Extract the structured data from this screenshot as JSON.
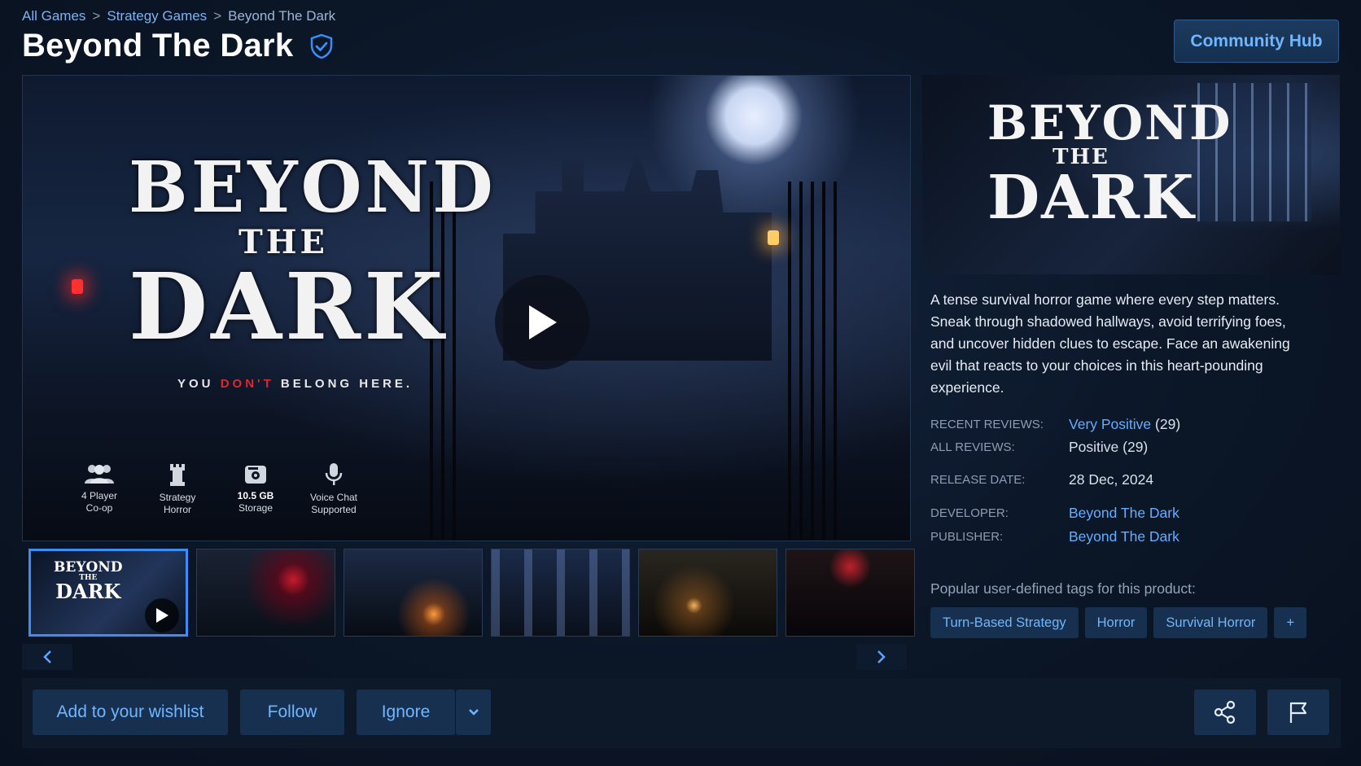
{
  "breadcrumb": {
    "items": [
      "All Games",
      "Strategy Games",
      "Beyond The Dark"
    ],
    "separator": ">"
  },
  "header": {
    "title": "Beyond The Dark",
    "community_hub_label": "Community Hub"
  },
  "media": {
    "hero_logo": [
      "BEYOND",
      "THE",
      "DARK"
    ],
    "tagline_pre": "YOU ",
    "tagline_red": "DON'T",
    "tagline_post": " BELONG HERE.",
    "features": [
      {
        "icon": "group-icon",
        "line1": "4 Player",
        "line2": "Co-op"
      },
      {
        "icon": "tower-icon",
        "line1": "Strategy",
        "line2": "Horror"
      },
      {
        "icon": "storage-icon",
        "line1": "10.5 GB",
        "line2": "Storage"
      },
      {
        "icon": "microphone-icon",
        "line1": "Voice Chat",
        "line2": "Supported"
      }
    ],
    "thumbnail_logo": [
      "BEYOND",
      "THE",
      "DARK"
    ]
  },
  "side": {
    "capsule_logo": [
      "BEYOND",
      "THE",
      "DARK"
    ],
    "description": "A tense survival horror game where every step matters. Sneak through shadowed hallways, avoid terrifying foes, and uncover hidden clues to escape. Face an awakening evil that reacts to your choices in this heart-pounding experience.",
    "recent_reviews_label": "RECENT REVIEWS:",
    "recent_reviews_value": "Very Positive",
    "recent_reviews_count": "(29)",
    "all_reviews_label": "ALL REVIEWS:",
    "all_reviews_value": "Positive (29)",
    "release_label": "RELEASE DATE:",
    "release_value": "28 Dec, 2024",
    "developer_label": "DEVELOPER:",
    "developer_value": "Beyond The Dark",
    "publisher_label": "PUBLISHER:",
    "publisher_value": "Beyond The Dark",
    "tags_label": "Popular user-defined tags for this product:",
    "tags": [
      "Turn-Based Strategy",
      "Horror",
      "Survival Horror",
      "+"
    ]
  },
  "actions": {
    "wishlist_label": "Add to your wishlist",
    "follow_label": "Follow",
    "ignore_label": "Ignore"
  },
  "colors": {
    "accent": "#63aeff",
    "button_bg": "#18304f",
    "page_bg": "#0b1627",
    "tagline_red": "#e0262a"
  }
}
